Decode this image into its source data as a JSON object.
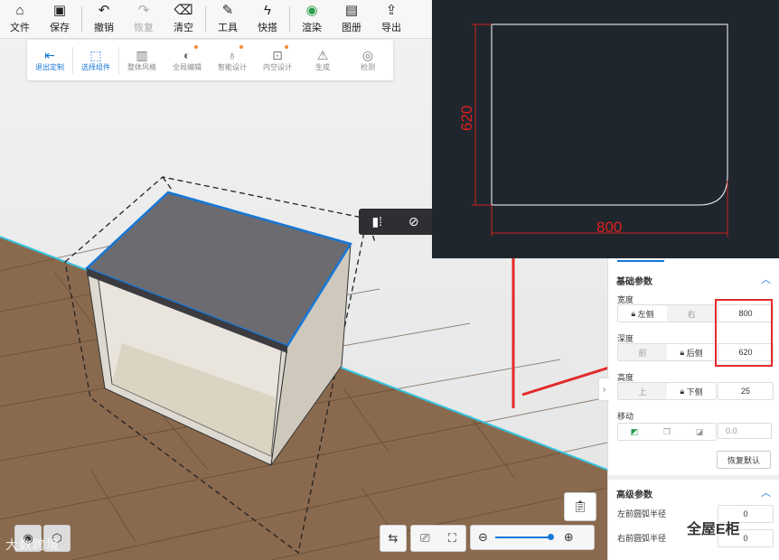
{
  "toolbar": {
    "items": [
      {
        "label": "文件",
        "icon": "home-icon",
        "enabled": true
      },
      {
        "label": "保存",
        "icon": "save-icon",
        "enabled": true
      },
      {
        "label": "撤销",
        "icon": "undo-icon",
        "enabled": true
      },
      {
        "label": "恢复",
        "icon": "redo-icon",
        "enabled": false
      },
      {
        "label": "清空",
        "icon": "eraser-icon",
        "enabled": true
      },
      {
        "label": "工具",
        "icon": "wrench-icon",
        "enabled": true
      },
      {
        "label": "快搭",
        "icon": "lightning-icon",
        "enabled": true
      },
      {
        "label": "渲染",
        "icon": "render-icon",
        "enabled": true
      },
      {
        "label": "图册",
        "icon": "album-icon",
        "enabled": true
      },
      {
        "label": "导出",
        "icon": "export-icon",
        "enabled": true
      }
    ]
  },
  "subbar": {
    "items": [
      {
        "label": "退出定制",
        "icon": "exit-icon",
        "active": true
      },
      {
        "label": "选择组件",
        "icon": "select-component-icon",
        "active": true
      },
      {
        "label": "整体风格",
        "icon": "paint-roller-icon",
        "active": false
      },
      {
        "label": "全局编辑",
        "icon": "global-edit-icon",
        "active": false
      },
      {
        "label": "智能设计",
        "icon": "smart-design-icon",
        "active": false
      },
      {
        "label": "内空设计",
        "icon": "interior-design-icon",
        "active": false
      },
      {
        "label": "生成",
        "icon": "generate-icon",
        "active": false
      },
      {
        "label": "检测",
        "icon": "detect-icon",
        "active": false
      }
    ]
  },
  "cad": {
    "width_label": "800",
    "depth_label": "620"
  },
  "panel": {
    "basic_title": "基础参数",
    "width": {
      "label": "宽度",
      "opt_left": "左侧",
      "opt_right": "右",
      "value": "800"
    },
    "depth": {
      "label": "深度",
      "opt_front": "前",
      "opt_back": "后侧",
      "value": "620"
    },
    "height": {
      "label": "高度",
      "opt_top": "上",
      "opt_bottom": "下侧",
      "value": "25"
    },
    "move": {
      "label": "移动",
      "value": "0.0"
    },
    "reset_label": "恢复默认",
    "advanced_title": "高级参数",
    "front_left_radius": {
      "label": "左前圆弧半径",
      "value": "0"
    },
    "front_right_radius": {
      "label": "右前圆弧半径",
      "value": "0"
    }
  },
  "watermark": {
    "left": "大数跨境",
    "right": "全屋E柜"
  },
  "colors": {
    "accent": "#1677d8",
    "highlight_red": "#e32a2a",
    "cad_bg": "#20262d"
  }
}
